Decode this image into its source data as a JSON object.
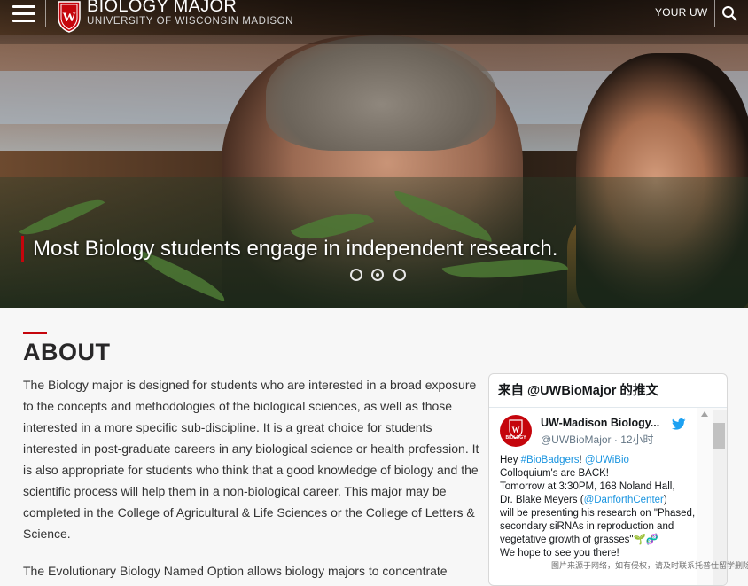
{
  "header": {
    "menu_icon": "hamburger-menu-icon",
    "title": "BIOLOGY MAJOR",
    "subtitle": "UNIVERSITY OF WISCONSIN MADISON",
    "crest_letter": "W",
    "your_uw": "YOUR UW",
    "search_icon": "search-icon"
  },
  "hero": {
    "caption": "Most Biology students engage in independent research.",
    "slides": 3,
    "active_slide": 2
  },
  "about": {
    "heading": "ABOUT",
    "paragraph1": "The Biology major is designed for students who are interested in a broad exposure to the concepts and methodologies of the biological sciences, as well as those interested in a more specific sub-discipline. It is a great choice for students interested in post-graduate careers in any biological science or health profession. It is also appropriate for students who think that a good knowledge of biology and the scientific process will help them in a non-biological career. This major may be completed in the College of Agricultural & Life Sciences or the College of Letters & Science.",
    "paragraph2": "The Evolutionary Biology Named Option allows biology majors to concentrate"
  },
  "twitter": {
    "header": "来自 @UWBioMajor 的推文",
    "avatar_label": "BIOLOGY",
    "name": "UW-Madison Biology...",
    "handle": "@UWBioMajor",
    "time": "· 12小时",
    "tweet": {
      "hey": "Hey ",
      "hashtag": "#BioBadgers",
      "excl": "! ",
      "mention1": "@UWiBio",
      "line2": "Colloquium's are BACK!",
      "line3": "Tomorrow at 3:30PM, 168 Noland Hall,",
      "line4a": "Dr. Blake Meyers (",
      "mention2": "@DanforthCenter",
      "line4b": ")",
      "line5": "will be presenting his research on \"Phased, secondary siRNAs in reproduction and vegetative growth of grasses\"🌱🧬",
      "line6": "We hope to see you there!"
    }
  },
  "watermark": "图片来源于网络，如有侵权，请及时联系托普仕留学删除"
}
